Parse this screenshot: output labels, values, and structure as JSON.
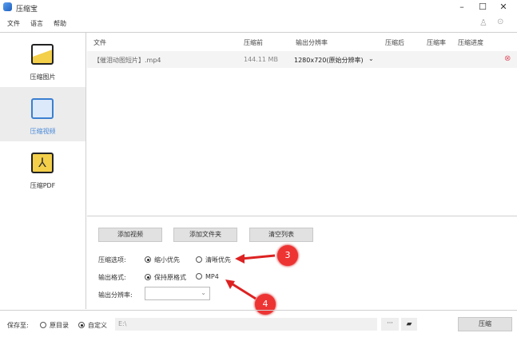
{
  "app": {
    "title": "压缩宝"
  },
  "menu": [
    "文件",
    "语言",
    "帮助"
  ],
  "sidebar": [
    {
      "label": "压缩图片"
    },
    {
      "label": "压缩视频"
    },
    {
      "label": "压缩PDF"
    }
  ],
  "table": {
    "headers": [
      "文件",
      "压缩前",
      "输出分辨率",
      "压缩后",
      "压缩率",
      "压缩进度"
    ],
    "rows": [
      {
        "file": "【催泪动图短片】.mp4",
        "before": "144.11 MB",
        "resolution": "1280x720(原始分辨率)",
        "after": "",
        "ratio": "",
        "progress": ""
      }
    ]
  },
  "buttons": {
    "add_video": "添加视频",
    "add_folder": "添加文件夹",
    "clear_list": "清空列表",
    "compress": "压缩",
    "browse": "···"
  },
  "options": {
    "compress_label": "压缩选项:",
    "compress_opts": [
      "缩小优先",
      "清晰优先"
    ],
    "format_label": "输出格式:",
    "format_opts": [
      "保持原格式",
      "MP4"
    ],
    "res_label": "输出分辨率:",
    "res_value": ""
  },
  "save": {
    "label": "保存至:",
    "opts": [
      "原目录",
      "自定义"
    ],
    "path": "E:\\"
  },
  "annotations": [
    "3",
    "4"
  ],
  "colors": {
    "accent": "#4a8ad8",
    "badge": "#e33333"
  }
}
